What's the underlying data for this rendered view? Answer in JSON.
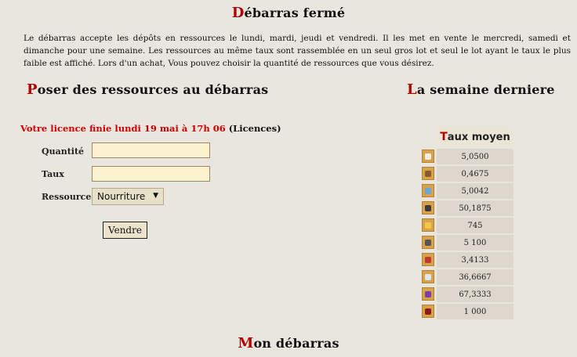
{
  "title": {
    "first": "D",
    "rest": "ébarras fermé"
  },
  "description": "Le débarras accepte les dépôts en ressources le lundi, mardi, jeudi et vendredi. Il les met en vente le mercredi, samedi et dimanche pour une semaine. Les ressources au même taux sont rassemblée en un seul gros lot et seul le lot ayant le taux le plus faible est affiché. Lors d'un achat, Vous pouvez choisir la quantité de ressources que vous désirez.",
  "poser": {
    "title_first": "P",
    "title_rest": "oser des ressources au débarras",
    "licence_text": "Votre licence finie lundi 19 mai à 17h 06",
    "licence_link": "(Licences)",
    "labels": {
      "quantity": "Quantité",
      "rate": "Taux",
      "resource": "Ressource"
    },
    "quantity_value": "",
    "rate_value": "",
    "resource_selected": "Nourriture",
    "sell_button": "Vendre"
  },
  "week": {
    "title_first": "L",
    "title_rest": "a semaine derniere",
    "header_first": "T",
    "header_rest": "aux moyen",
    "rows": [
      {
        "icon": "food-icon",
        "value": "5,0500",
        "color": "#f3f0e6"
      },
      {
        "icon": "wood-icon",
        "value": "0,4675",
        "color": "#8b5a2b"
      },
      {
        "icon": "metal-icon",
        "value": "5,0042",
        "color": "#6aa7d8"
      },
      {
        "icon": "quill-icon",
        "value": "50,1875",
        "color": "#3b3b3b"
      },
      {
        "icon": "gold-icon",
        "value": "745",
        "color": "#f2c84b"
      },
      {
        "icon": "stone-icon",
        "value": "5 100",
        "color": "#555555"
      },
      {
        "icon": "gem-icon",
        "value": "3,4133",
        "color": "#c0392b"
      },
      {
        "icon": "crystal-icon",
        "value": "36,6667",
        "color": "#dfe6f2"
      },
      {
        "icon": "amethyst-icon",
        "value": "67,3333",
        "color": "#7a3fa0"
      },
      {
        "icon": "cloth-icon",
        "value": "1 000",
        "color": "#8e1b1b"
      }
    ]
  },
  "mon": {
    "title_first": "M",
    "title_rest": "on débarras"
  }
}
